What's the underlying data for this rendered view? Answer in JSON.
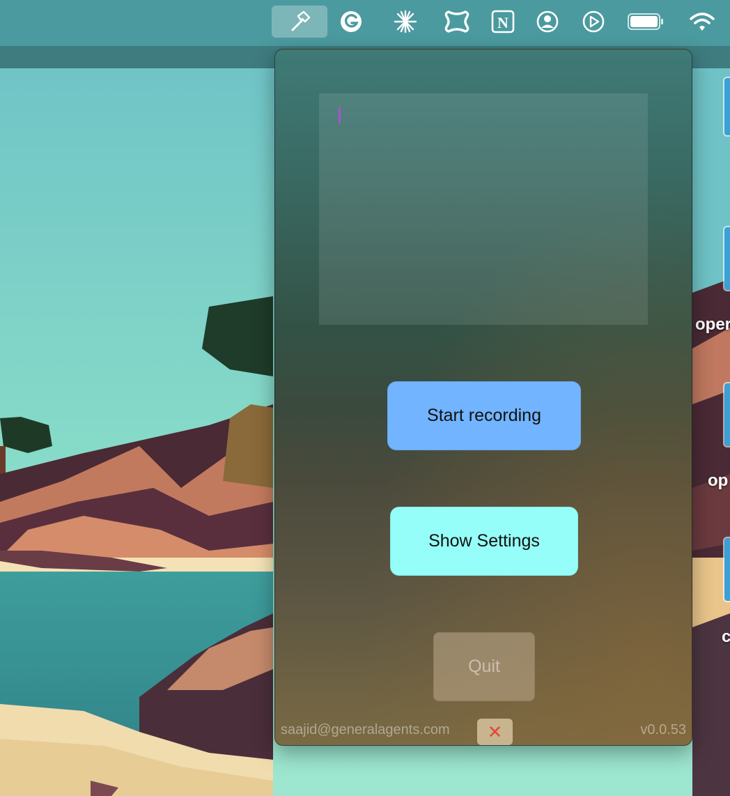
{
  "menubar": {
    "items": [
      {
        "icon": "hammer-icon",
        "active": true
      },
      {
        "icon": "grammarly-icon"
      },
      {
        "icon": "sparkle-icon"
      },
      {
        "icon": "squircle-app-icon"
      },
      {
        "icon": "notion-icon"
      },
      {
        "icon": "user-circle-icon"
      },
      {
        "icon": "play-circle-icon"
      },
      {
        "icon": "battery-icon"
      },
      {
        "icon": "wifi-icon"
      }
    ]
  },
  "desktop": {
    "labels": [
      "oper",
      "op",
      "c"
    ]
  },
  "panel": {
    "textarea_value": "",
    "start_button": "Start recording",
    "settings_button": "Show Settings",
    "quit_button": "Quit",
    "footer": {
      "email": "saajid@generalagents.com",
      "version": "v0.0.53",
      "close_glyph": "✕"
    }
  },
  "colors": {
    "start_button": "#72b4ff",
    "settings_button": "#95fef8",
    "caret": "#b04fc9",
    "close_glyph": "#e04a3a"
  }
}
